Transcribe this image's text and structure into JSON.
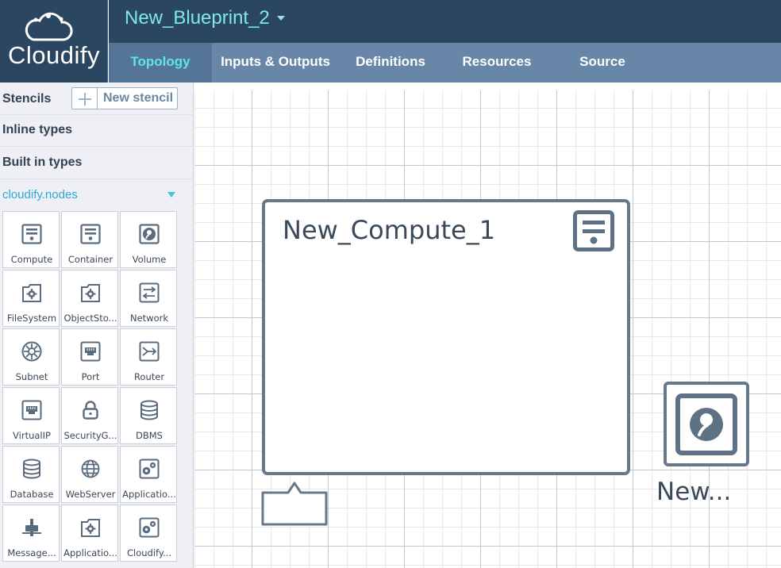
{
  "app": {
    "logo_text": "Cloudify"
  },
  "blueprint": {
    "title": "New_Blueprint_2"
  },
  "tabs": [
    {
      "label": "Topology",
      "active": true
    },
    {
      "label": "Inputs & Outputs"
    },
    {
      "label": "Definitions"
    },
    {
      "label": "Resources"
    },
    {
      "label": "Source"
    }
  ],
  "sidebar": {
    "stencils_label": "Stencils",
    "new_stencil_label": "New stencil",
    "inline_types_label": "Inline types",
    "built_in_types_label": "Built in types",
    "namespace_label": "cloudify.nodes",
    "items": [
      {
        "label": "Compute",
        "icon": "server-icon"
      },
      {
        "label": "Container",
        "icon": "server-icon"
      },
      {
        "label": "Volume",
        "icon": "disk-icon"
      },
      {
        "label": "FileSystem",
        "icon": "folder-gear-icon"
      },
      {
        "label": "ObjectSto...",
        "icon": "folder-gear-icon"
      },
      {
        "label": "Network",
        "icon": "network-arrows-icon"
      },
      {
        "label": "Subnet",
        "icon": "subnet-icon"
      },
      {
        "label": "Port",
        "icon": "port-icon"
      },
      {
        "label": "Router",
        "icon": "router-icon"
      },
      {
        "label": "VirtualIP",
        "icon": "port-icon"
      },
      {
        "label": "SecurityG...",
        "icon": "lock-icon"
      },
      {
        "label": "DBMS",
        "icon": "database-icon"
      },
      {
        "label": "Database",
        "icon": "database-icon"
      },
      {
        "label": "WebServer",
        "icon": "globe-icon"
      },
      {
        "label": "Applicatio...",
        "icon": "gears-icon"
      },
      {
        "label": "Message...",
        "icon": "message-queue-icon"
      },
      {
        "label": "Applicatio...",
        "icon": "folder-gear-icon"
      },
      {
        "label": "Cloudify...",
        "icon": "gears-icon"
      }
    ]
  },
  "canvas": {
    "nodes": [
      {
        "name": "New_Compute_1",
        "icon": "server-icon"
      },
      {
        "name": "New...",
        "icon": "disk-icon"
      }
    ]
  },
  "colors": {
    "header_bg": "#2b4660",
    "tabbar_bg": "#6887a8",
    "accent": "#5fe4e9",
    "node_stroke": "#66788a",
    "link": "#2aa9d8"
  }
}
